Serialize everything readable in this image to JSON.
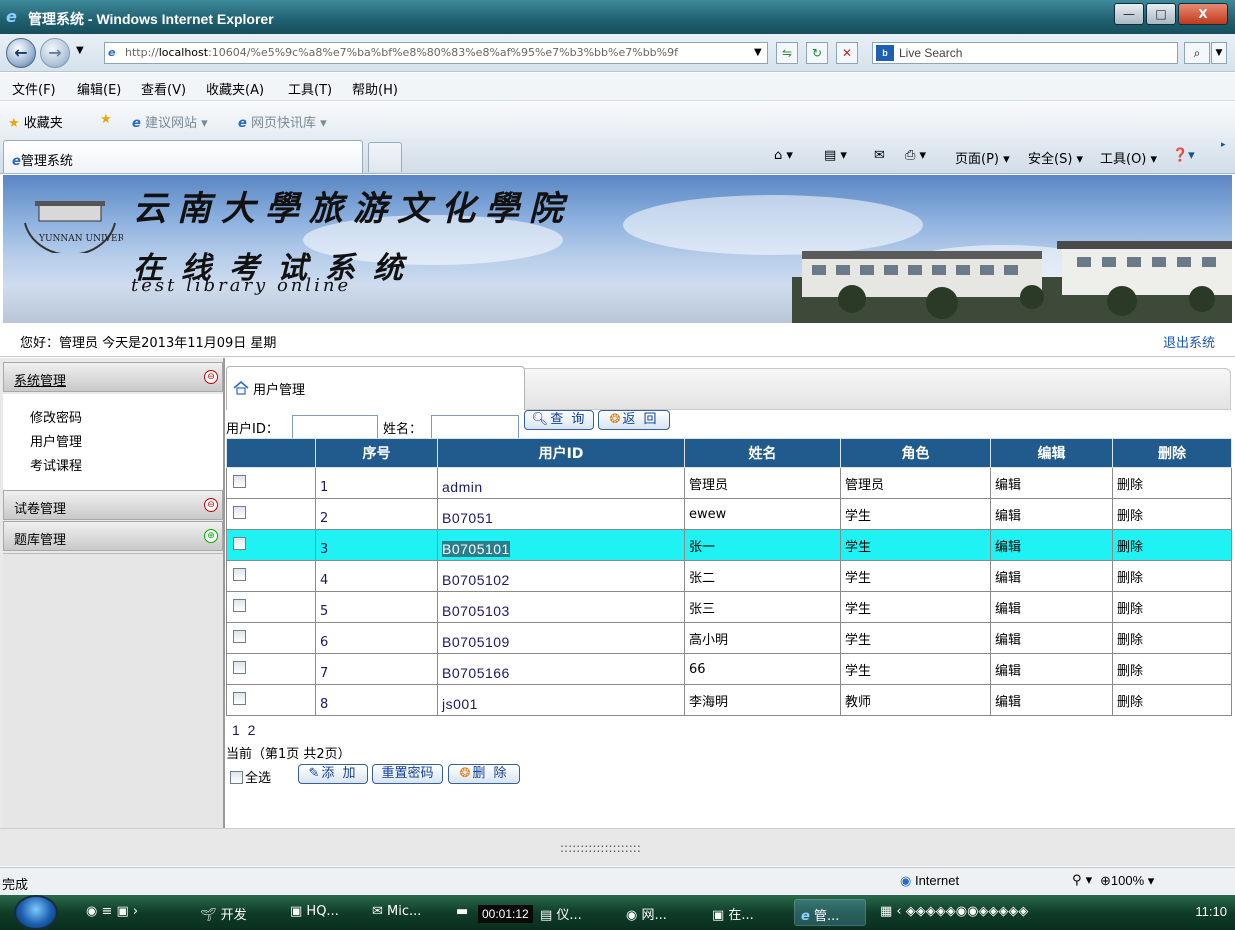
{
  "window": {
    "title": "管理系统 - Windows Internet Explorer",
    "minimize": "—",
    "maximize": "□",
    "close": "X"
  },
  "addressbar": {
    "url_prefix": "http://",
    "url_host": "localhost",
    "url_rest": ":10604/%e5%9c%a8%e7%ba%bf%e8%80%83%e8%af%95%e7%b3%bb%e7%bb%9f",
    "search_placeholder": "Live Search"
  },
  "menu": [
    "文件(F)",
    "编辑(E)",
    "查看(V)",
    "收藏夹(A)",
    "工具(T)",
    "帮助(H)"
  ],
  "favorites": {
    "label": "收藏夹",
    "suggested": "建议网站 ▾",
    "webslice": "网页快讯库 ▾"
  },
  "tabs": {
    "active": "管理系统"
  },
  "commands": {
    "page": "页面(P) ▾",
    "safety": "安全(S) ▾",
    "tools": "工具(O) ▾"
  },
  "banner": {
    "school": "云南大學旅游文化學院",
    "system": "在线考试系统",
    "english": "test library online",
    "logo_text": "YUNNAN UNIVERSITY"
  },
  "greeting": {
    "text": "您好：管理员   今天是2013年11月09日  星期",
    "logout": "退出系统"
  },
  "sidebar": {
    "groups": [
      {
        "label": "系统管理",
        "toggle": "⊖"
      },
      {
        "label": "试卷管理",
        "toggle": "⊖"
      },
      {
        "label": "题库管理",
        "toggle": "⊕"
      }
    ],
    "system_items": [
      "修改密码",
      "用户管理",
      "考试课程"
    ]
  },
  "panel": {
    "tab_title": "用户管理",
    "filter_userid_label": "用户ID：",
    "filter_name_label": "姓名：",
    "query_button": "查 询",
    "back_button": "返 回"
  },
  "table": {
    "headers": [
      "",
      "序号",
      "用户ID",
      "姓名",
      "角色",
      "编辑",
      "删除"
    ],
    "rows": [
      {
        "no": "1",
        "uid": "admin",
        "name": "管理员",
        "role": "管理员",
        "edit": "编辑",
        "del": "删除"
      },
      {
        "no": "2",
        "uid": "B07051",
        "name": "ewew",
        "role": "学生",
        "edit": "编辑",
        "del": "删除"
      },
      {
        "no": "3",
        "uid": "B0705101",
        "name": "张一",
        "role": "学生",
        "edit": "编辑",
        "del": "删除"
      },
      {
        "no": "4",
        "uid": "B0705102",
        "name": "张二",
        "role": "学生",
        "edit": "编辑",
        "del": "删除"
      },
      {
        "no": "5",
        "uid": "B0705103",
        "name": "张三",
        "role": "学生",
        "edit": "编辑",
        "del": "删除"
      },
      {
        "no": "6",
        "uid": "B0705109",
        "name": "高小明",
        "role": "学生",
        "edit": "编辑",
        "del": "删除"
      },
      {
        "no": "7",
        "uid": "B0705166",
        "name": "66",
        "role": "学生",
        "edit": "编辑",
        "del": "删除"
      },
      {
        "no": "8",
        "uid": "js001",
        "name": "李海明",
        "role": "教师",
        "edit": "编辑",
        "del": "删除"
      }
    ],
    "selected_row": 3
  },
  "pager": {
    "pages": "1 2",
    "info": "当前（第1页 共2页）"
  },
  "actions": {
    "select_all": "全选",
    "add": "添 加",
    "reset_password": "重置密码",
    "delete": "删 除"
  },
  "splitter": "::::::::::::::::::::",
  "status": {
    "text": "完成",
    "zone": "Internet",
    "zoom": "100%"
  },
  "taskbar": {
    "items": [
      "开发",
      "HQ...",
      "Mic...",
      "仪...",
      "网...",
      "在...",
      "管..."
    ],
    "timer": "00:01:12",
    "clock": "11:10"
  }
}
